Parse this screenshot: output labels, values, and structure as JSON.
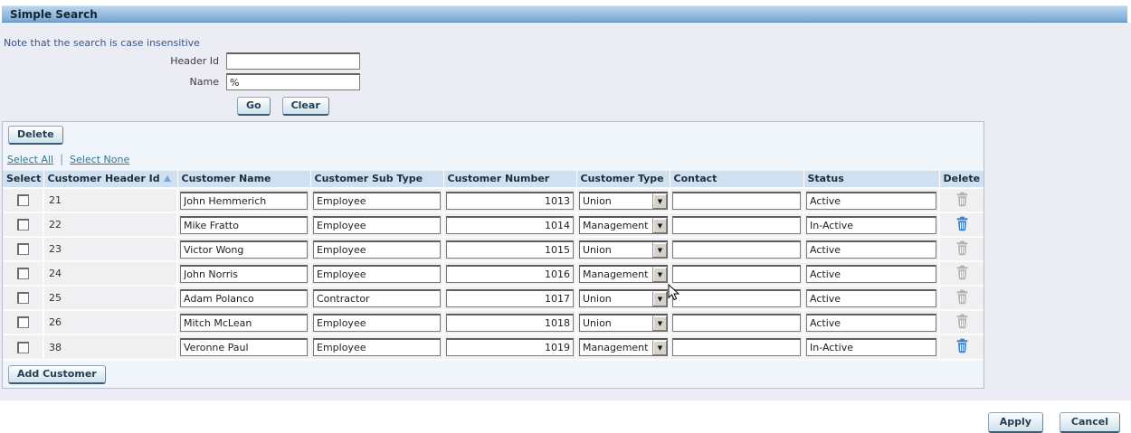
{
  "colors": {
    "title_bar_top": "#b9d5ec",
    "title_bar_bottom": "#78a6d3",
    "page_background": "#ececf5",
    "panel_background": "#f0f5fb",
    "table_header_background": "#cfe1f1",
    "note_text": "#33568c",
    "link_text": "#33758c",
    "trash_enabled": "#3f7ec9",
    "trash_disabled": "#b2b2b2",
    "sort_arrow": "#7aa3d6"
  },
  "search": {
    "title": "Simple Search",
    "note": "Note that the search is case insensitive",
    "header_id_label": "Header Id",
    "header_id_value": "",
    "name_label": "Name",
    "name_value": "%",
    "go_label": "Go",
    "clear_label": "Clear"
  },
  "grid": {
    "delete_label": "Delete",
    "select_all_label": "Select All",
    "select_none_label": "Select None",
    "add_customer_label": "Add Customer",
    "columns": [
      "Select",
      "Customer Header Id",
      "Customer Name",
      "Customer Sub Type",
      "Customer Number",
      "Customer Type",
      "Contact",
      "Status",
      "Delete"
    ],
    "sorted_column": "Customer Header Id",
    "sort_direction": "ascending",
    "rows": [
      {
        "header_id": "21",
        "name": "John Hemmerich",
        "sub_type": "Employee",
        "number": "1013",
        "type": "Union",
        "contact": "",
        "status": "Active",
        "delete_enabled": false
      },
      {
        "header_id": "22",
        "name": "Mike Fratto",
        "sub_type": "Employee",
        "number": "1014",
        "type": "Management",
        "contact": "",
        "status": "In-Active",
        "delete_enabled": true
      },
      {
        "header_id": "23",
        "name": "Victor Wong",
        "sub_type": "Employee",
        "number": "1015",
        "type": "Union",
        "contact": "",
        "status": "Active",
        "delete_enabled": false
      },
      {
        "header_id": "24",
        "name": "John Norris",
        "sub_type": "Employee",
        "number": "1016",
        "type": "Management",
        "contact": "",
        "status": "Active",
        "delete_enabled": false
      },
      {
        "header_id": "25",
        "name": "Adam Polanco",
        "sub_type": "Contractor",
        "number": "1017",
        "type": "Union",
        "contact": "",
        "status": "Active",
        "delete_enabled": false
      },
      {
        "header_id": "26",
        "name": "Mitch McLean",
        "sub_type": "Employee",
        "number": "1018",
        "type": "Union",
        "contact": "",
        "status": "Active",
        "delete_enabled": false
      },
      {
        "header_id": "38",
        "name": "Veronne Paul",
        "sub_type": "Employee",
        "number": "1019",
        "type": "Management",
        "contact": "",
        "status": "In-Active",
        "delete_enabled": true
      }
    ]
  },
  "footer": {
    "apply_label": "Apply",
    "cancel_label": "Cancel"
  }
}
